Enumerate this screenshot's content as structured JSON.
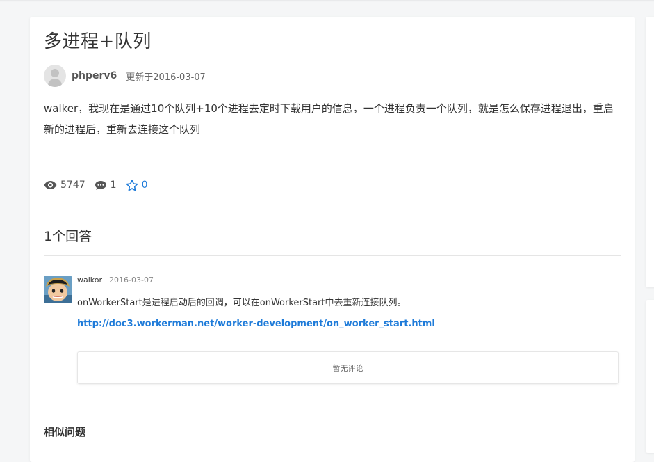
{
  "question": {
    "title": "多进程+队列",
    "author": "phperv6",
    "updated": "更新于2016-03-07",
    "avatar_icon": "default-user-avatar-icon",
    "content": "walker，我现在是通过10个队列+10个进程去定时下载用户的信息，一个进程负责一个队列，就是怎么保存进程退出，重启新的进程后，重新去连接这个队列",
    "stats": {
      "views": "5747",
      "views_icon": "eye-icon",
      "comments": "1",
      "comments_icon": "comment-icon",
      "favorites": "0",
      "favorites_icon": "star-icon"
    }
  },
  "answers": {
    "title": "1个回答",
    "items": [
      {
        "author": "walkor",
        "date": "2016-03-07",
        "avatar_icon": "cartoon-avatar-icon",
        "text": "onWorkerStart是进程启动后的回调，可以在onWorkerStart中去重新连接队列。",
        "link": "http://doc3.workerman.net/worker-development/on_worker_start.html",
        "comments_empty": "暂无评论"
      }
    ]
  },
  "similar": {
    "title": "相似问题"
  },
  "colors": {
    "accent": "#1e7bd9",
    "background": "#f5f6f7",
    "card": "#ffffff"
  }
}
